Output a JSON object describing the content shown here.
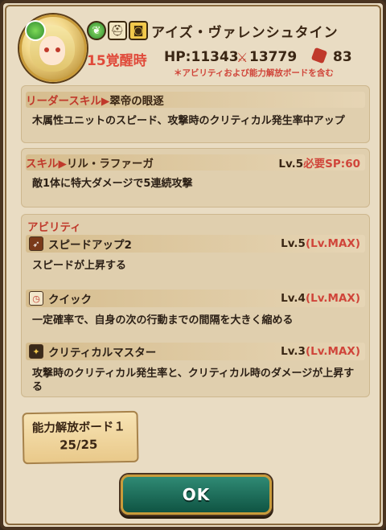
{
  "unit": {
    "name": "アイズ・ヴァレンシュタイン",
    "awakening": "15覚醒時",
    "hp_text": "HP:11343",
    "attack": "13779",
    "speed": "83",
    "note": "＊アビリティおよび能力解放ボードを含む",
    "element_icon": "leaf-icon",
    "type_icon": "helmet-icon",
    "subtype_icon": "mask-icon"
  },
  "leader_skill": {
    "label": "リーダースキル▶",
    "name": "翠帝の眼逐",
    "description": "木属性ユニットのスピード、攻撃時のクリティカル発生率中アップ"
  },
  "skill": {
    "label": "スキル▶",
    "name": "リル・ラファーガ",
    "level": "Lv.5",
    "sp": "必要SP:60",
    "description": "敵1体に特大ダメージで5連続攻撃"
  },
  "abilities": {
    "label": "アビリティ",
    "items": [
      {
        "name": "スピードアップ2",
        "level": "Lv.5",
        "max": "(Lv.MAX)",
        "description": "スピードが上昇する"
      },
      {
        "name": "クイック",
        "level": "Lv.4",
        "max": "(Lv.MAX)",
        "description": "一定確率で、自身の次の行動までの間隔を大きく縮める"
      },
      {
        "name": "クリティカルマスター",
        "level": "Lv.3",
        "max": "(Lv.MAX)",
        "description": "攻撃時のクリティカル発生率と、クリティカル時のダメージが上昇する"
      }
    ]
  },
  "board": {
    "title": "能力解放ボード１",
    "count": "25/25"
  },
  "ok_button": {
    "label": "OK"
  },
  "colors": {
    "accent_red": "#d0453a",
    "panel": "#e0cfae",
    "ok_green": "#1f6e5a"
  }
}
